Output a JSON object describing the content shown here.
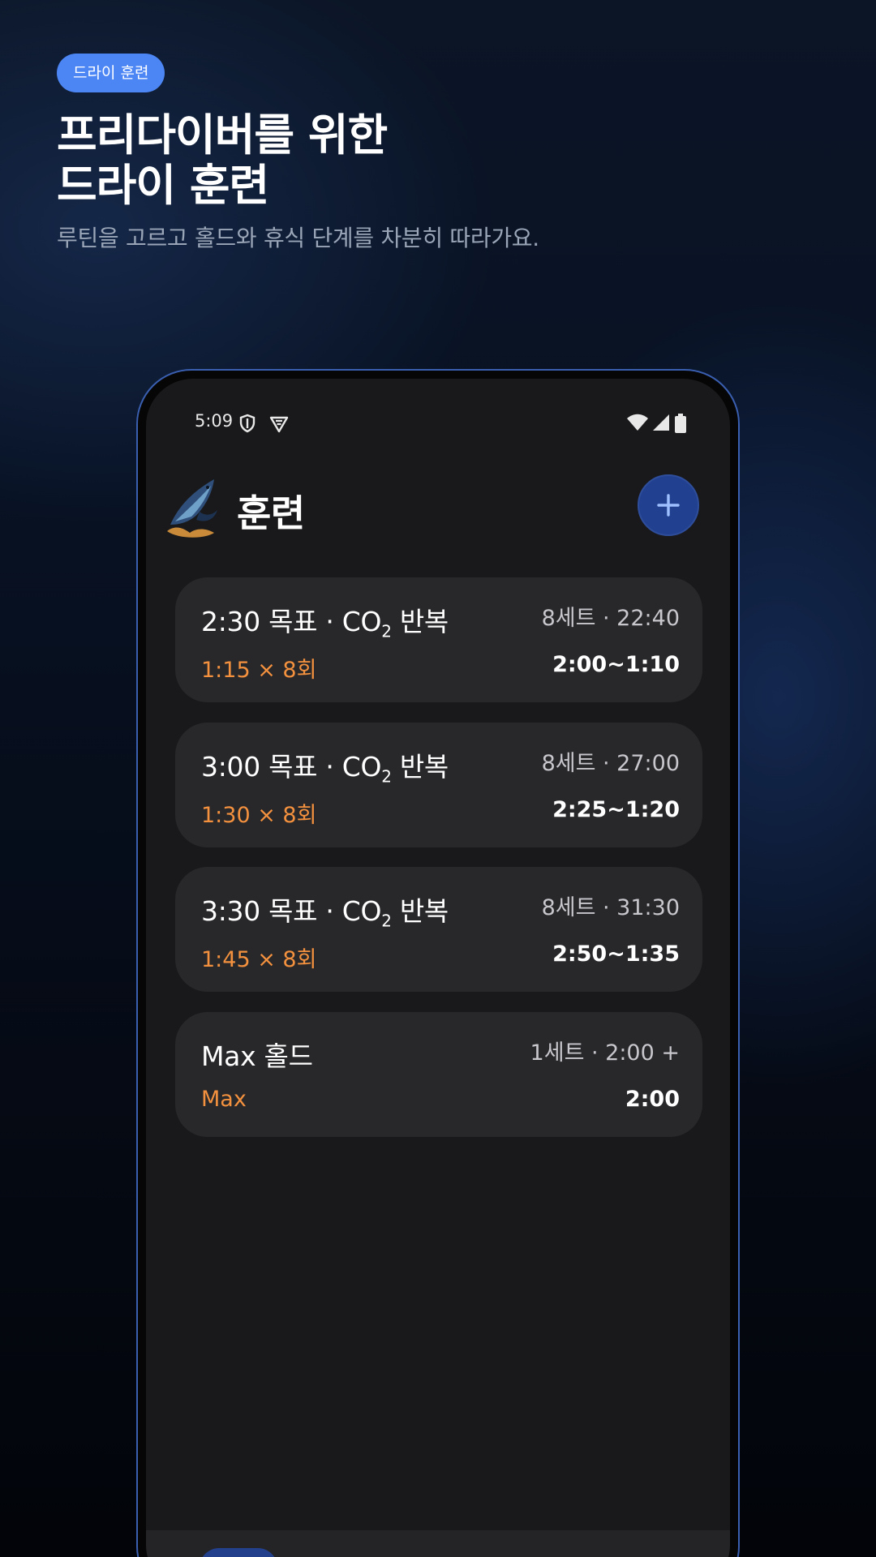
{
  "hero": {
    "chip": "드라이 훈련",
    "headline_line1": "프리다이버를 위한",
    "headline_line2": "드라이 훈련",
    "subtitle": "루틴을 고르고 홀드와 휴식 단계를 차분히 따라가요."
  },
  "status_bar": {
    "time": "5:09",
    "icons": [
      "shield-icon",
      "vpn-icon",
      "wifi-icon",
      "signal-icon",
      "battery-icon"
    ]
  },
  "app": {
    "title": "훈련",
    "add_icon": "plus-icon",
    "logo_icon": "whale-logo"
  },
  "routines": [
    {
      "target": "2:30 목표 · CO",
      "sub": "2",
      "suffix": " 반복",
      "meta": "8세트 · 22:40",
      "reps": "1:15 × 8회",
      "range": "2:00~1:10"
    },
    {
      "target": "3:00 목표 · CO",
      "sub": "2",
      "suffix": " 반복",
      "meta": "8세트 · 27:00",
      "reps": "1:30 × 8회",
      "range": "2:25~1:20"
    },
    {
      "target": "3:30 목표 · CO",
      "sub": "2",
      "suffix": " 반복",
      "meta": "8세트 · 31:30",
      "reps": "1:45 × 8회",
      "range": "2:50~1:35"
    },
    {
      "target": "Max 홀드",
      "sub": "",
      "suffix": "",
      "meta": "1세트 · 2:00 +",
      "reps": "Max",
      "range": "2:00"
    }
  ],
  "colors": {
    "chip_bg": "#4c86f5",
    "accent_orange": "#f3913e",
    "fab_bg": "#21408f",
    "card_bg": "#28282b",
    "screen_bg": "#19191b"
  }
}
